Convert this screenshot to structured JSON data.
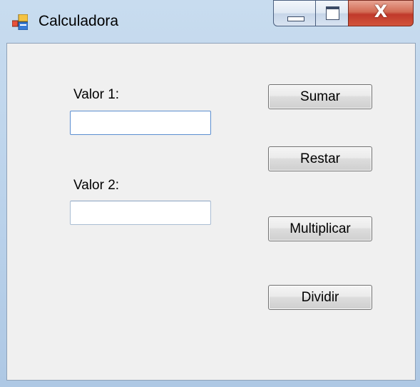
{
  "window": {
    "title": "Calculadora",
    "close_glyph": "X"
  },
  "form": {
    "label1": "Valor 1:",
    "label2": "Valor 2:",
    "input1_value": "",
    "input2_value": ""
  },
  "buttons": {
    "sumar": "Sumar",
    "restar": "Restar",
    "multiplicar": "Multiplicar",
    "dividir": "Dividir"
  },
  "icons": {
    "app": "window-form-icon",
    "minimize": "minimize-icon",
    "maximize": "maximize-icon",
    "close": "close-icon"
  },
  "colors": {
    "titlebar": "#b9d1ea",
    "close_button": "#c0392b",
    "client_bg": "#f0f0f0"
  }
}
